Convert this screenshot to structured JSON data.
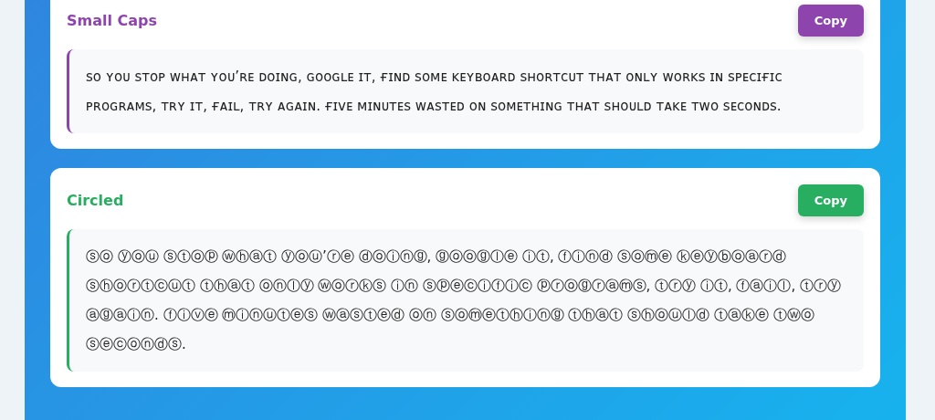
{
  "styles": [
    {
      "title": "Small Caps",
      "color": "#8e44ad",
      "button": "Copy",
      "text": "ꜱᴏ ʏᴏᴜ ꜱᴛᴏᴘ ᴡʜᴀᴛ ʏᴏᴜ’ʀᴇ ᴅᴏɪɴɢ, ɢᴏᴏɢʟᴇ ɪᴛ, ғɪɴᴅ ꜱᴏᴍᴇ ᴋᴇʏʙᴏᴀʀᴅ ꜱʜᴏʀᴛᴄᴜᴛ ᴛʜᴀᴛ ᴏɴʟʏ ᴡᴏʀᴋꜱ ɪɴ ꜱᴘᴇᴄɪғɪᴄ ᴘʀᴏɢʀᴀᴍꜱ, ᴛʀʏ ɪᴛ, ғᴀɪʟ, ᴛʀʏ ᴀɢᴀɪɴ. ғɪᴠᴇ ᴍɪɴᴜᴛᴇꜱ ᴡᴀꜱᴛᴇᴅ ᴏɴ ꜱᴏᴍᴇᴛʜɪɴɢ ᴛʜᴀᴛ ꜱʜᴏᴜʟᴅ ᴛᴀᴋᴇ ᴛᴡᴏ ꜱᴇᴄᴏɴᴅꜱ."
    },
    {
      "title": "Circled",
      "color": "#27ae60",
      "button": "Copy",
      "text": "ⓢⓞ ⓨⓞⓤ ⓢⓣⓞⓟ ⓦⓗⓐⓣ ⓨⓞⓤ’ⓡⓔ ⓓⓞⓘⓝⓖ, ⓖⓞⓞⓖⓛⓔ ⓘⓣ, ⓕⓘⓝⓓ ⓢⓞⓜⓔ ⓚⓔⓨⓑⓞⓐⓡⓓ ⓢⓗⓞⓡⓣⓒⓤⓣ ⓣⓗⓐⓣ ⓞⓝⓛⓨ ⓦⓞⓡⓚⓢ ⓘⓝ ⓢⓟⓔⓒⓘⓕⓘⓒ ⓟⓡⓞⓖⓡⓐⓜⓢ, ⓣⓡⓨ ⓘⓣ, ⓕⓐⓘⓛ, ⓣⓡⓨ ⓐⓖⓐⓘⓝ. ⓕⓘⓥⓔ ⓜⓘⓝⓤⓣⓔⓢ ⓦⓐⓢⓣⓔⓓ ⓞⓝ ⓢⓞⓜⓔⓣⓗⓘⓝⓖ ⓣⓗⓐⓣ ⓢⓗⓞⓤⓛⓓ ⓣⓐⓚⓔ ⓣⓦⓞ ⓢⓔⓒⓞⓝⓓⓢ."
    }
  ]
}
